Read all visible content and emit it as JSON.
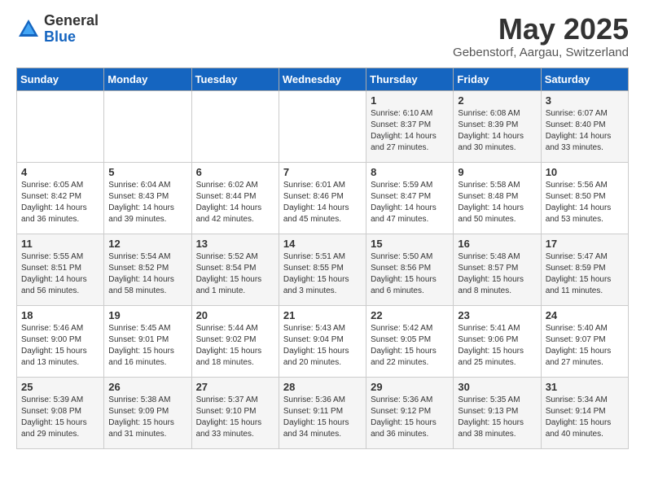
{
  "logo": {
    "general": "General",
    "blue": "Blue"
  },
  "header": {
    "month": "May 2025",
    "location": "Gebenstorf, Aargau, Switzerland"
  },
  "weekdays": [
    "Sunday",
    "Monday",
    "Tuesday",
    "Wednesday",
    "Thursday",
    "Friday",
    "Saturday"
  ],
  "weeks": [
    [
      null,
      null,
      null,
      null,
      {
        "day": "1",
        "sunrise": "6:10 AM",
        "sunset": "8:37 PM",
        "daylight": "14 hours and 27 minutes."
      },
      {
        "day": "2",
        "sunrise": "6:08 AM",
        "sunset": "8:39 PM",
        "daylight": "14 hours and 30 minutes."
      },
      {
        "day": "3",
        "sunrise": "6:07 AM",
        "sunset": "8:40 PM",
        "daylight": "14 hours and 33 minutes."
      }
    ],
    [
      {
        "day": "4",
        "sunrise": "6:05 AM",
        "sunset": "8:42 PM",
        "daylight": "14 hours and 36 minutes."
      },
      {
        "day": "5",
        "sunrise": "6:04 AM",
        "sunset": "8:43 PM",
        "daylight": "14 hours and 39 minutes."
      },
      {
        "day": "6",
        "sunrise": "6:02 AM",
        "sunset": "8:44 PM",
        "daylight": "14 hours and 42 minutes."
      },
      {
        "day": "7",
        "sunrise": "6:01 AM",
        "sunset": "8:46 PM",
        "daylight": "14 hours and 45 minutes."
      },
      {
        "day": "8",
        "sunrise": "5:59 AM",
        "sunset": "8:47 PM",
        "daylight": "14 hours and 47 minutes."
      },
      {
        "day": "9",
        "sunrise": "5:58 AM",
        "sunset": "8:48 PM",
        "daylight": "14 hours and 50 minutes."
      },
      {
        "day": "10",
        "sunrise": "5:56 AM",
        "sunset": "8:50 PM",
        "daylight": "14 hours and 53 minutes."
      }
    ],
    [
      {
        "day": "11",
        "sunrise": "5:55 AM",
        "sunset": "8:51 PM",
        "daylight": "14 hours and 56 minutes."
      },
      {
        "day": "12",
        "sunrise": "5:54 AM",
        "sunset": "8:52 PM",
        "daylight": "14 hours and 58 minutes."
      },
      {
        "day": "13",
        "sunrise": "5:52 AM",
        "sunset": "8:54 PM",
        "daylight": "15 hours and 1 minute."
      },
      {
        "day": "14",
        "sunrise": "5:51 AM",
        "sunset": "8:55 PM",
        "daylight": "15 hours and 3 minutes."
      },
      {
        "day": "15",
        "sunrise": "5:50 AM",
        "sunset": "8:56 PM",
        "daylight": "15 hours and 6 minutes."
      },
      {
        "day": "16",
        "sunrise": "5:48 AM",
        "sunset": "8:57 PM",
        "daylight": "15 hours and 8 minutes."
      },
      {
        "day": "17",
        "sunrise": "5:47 AM",
        "sunset": "8:59 PM",
        "daylight": "15 hours and 11 minutes."
      }
    ],
    [
      {
        "day": "18",
        "sunrise": "5:46 AM",
        "sunset": "9:00 PM",
        "daylight": "15 hours and 13 minutes."
      },
      {
        "day": "19",
        "sunrise": "5:45 AM",
        "sunset": "9:01 PM",
        "daylight": "15 hours and 16 minutes."
      },
      {
        "day": "20",
        "sunrise": "5:44 AM",
        "sunset": "9:02 PM",
        "daylight": "15 hours and 18 minutes."
      },
      {
        "day": "21",
        "sunrise": "5:43 AM",
        "sunset": "9:04 PM",
        "daylight": "15 hours and 20 minutes."
      },
      {
        "day": "22",
        "sunrise": "5:42 AM",
        "sunset": "9:05 PM",
        "daylight": "15 hours and 22 minutes."
      },
      {
        "day": "23",
        "sunrise": "5:41 AM",
        "sunset": "9:06 PM",
        "daylight": "15 hours and 25 minutes."
      },
      {
        "day": "24",
        "sunrise": "5:40 AM",
        "sunset": "9:07 PM",
        "daylight": "15 hours and 27 minutes."
      }
    ],
    [
      {
        "day": "25",
        "sunrise": "5:39 AM",
        "sunset": "9:08 PM",
        "daylight": "15 hours and 29 minutes."
      },
      {
        "day": "26",
        "sunrise": "5:38 AM",
        "sunset": "9:09 PM",
        "daylight": "15 hours and 31 minutes."
      },
      {
        "day": "27",
        "sunrise": "5:37 AM",
        "sunset": "9:10 PM",
        "daylight": "15 hours and 33 minutes."
      },
      {
        "day": "28",
        "sunrise": "5:36 AM",
        "sunset": "9:11 PM",
        "daylight": "15 hours and 34 minutes."
      },
      {
        "day": "29",
        "sunrise": "5:36 AM",
        "sunset": "9:12 PM",
        "daylight": "15 hours and 36 minutes."
      },
      {
        "day": "30",
        "sunrise": "5:35 AM",
        "sunset": "9:13 PM",
        "daylight": "15 hours and 38 minutes."
      },
      {
        "day": "31",
        "sunrise": "5:34 AM",
        "sunset": "9:14 PM",
        "daylight": "15 hours and 40 minutes."
      }
    ]
  ]
}
